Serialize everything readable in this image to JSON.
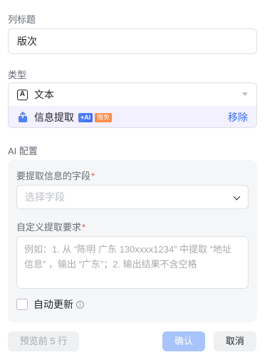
{
  "column_title": {
    "label": "列标题",
    "value": "版次"
  },
  "type": {
    "label": "类型",
    "selected_option": "文本",
    "text_icon_glyph": "A",
    "ai_field": {
      "label": "信息提取",
      "badge_ai": "+AI",
      "badge_free": "限免",
      "remove_label": "移除"
    }
  },
  "ai_config": {
    "label": "AI 配置",
    "field_to_extract": {
      "label": "要提取信息的字段",
      "required_mark": "*",
      "placeholder": "选择字段"
    },
    "custom_requirement": {
      "label": "自定义提取要求",
      "required_mark": "*",
      "placeholder": "例如：1. 从 “陈明 广东 130xxxx1234” 中提取 “地址信息” ，输出 “广东”；2. 输出结果不含空格"
    },
    "auto_update": {
      "label": "自动更新",
      "checked": false,
      "info_glyph": "i"
    }
  },
  "footer": {
    "preview_label": "预览前 5 行",
    "confirm_label": "确认",
    "cancel_label": "取消"
  },
  "colors": {
    "accent": "#3370ff",
    "required": "#f54a45",
    "highlight_row": "#f3f0ff",
    "free_badge": "#ff8a45"
  },
  "icons": [
    "text-type-icon",
    "info-extract-icon",
    "chevron-down-icon",
    "caret-down-icon",
    "info-icon"
  ]
}
